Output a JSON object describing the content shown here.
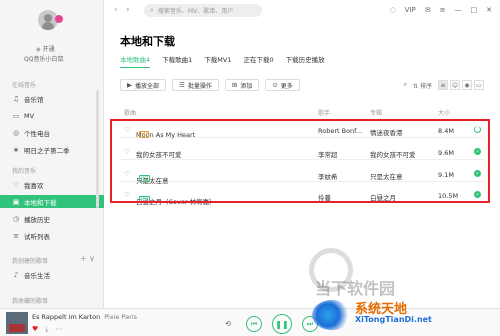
{
  "sidebar": {
    "open_label": "开通",
    "username": "QQ音乐小白鼠",
    "sections": [
      {
        "title": "在线音乐"
      },
      {
        "title": "我的音乐"
      },
      {
        "title": "我创建的歌单"
      },
      {
        "title": "我收藏的歌单"
      }
    ],
    "online_items": [
      {
        "label": "音乐馆",
        "icon": "music-hall-icon"
      },
      {
        "label": "MV",
        "icon": "mv-icon"
      },
      {
        "label": "个性电台",
        "icon": "radio-icon"
      },
      {
        "label": "明日之子第二季",
        "icon": "star-icon"
      }
    ],
    "my_items": [
      {
        "label": "我喜欢",
        "icon": "heart-icon"
      },
      {
        "label": "本地和下载",
        "icon": "computer-icon",
        "active": true
      },
      {
        "label": "播放历史",
        "icon": "history-icon"
      },
      {
        "label": "试听列表",
        "icon": "list-icon"
      }
    ],
    "created_items": [
      {
        "label": "音乐生活",
        "icon": "playlist-icon"
      }
    ]
  },
  "topbar": {
    "search_placeholder": "搜索音乐、MV、歌单、用户",
    "vip_label": "VIP"
  },
  "page": {
    "title": "本地和下载",
    "tabs": [
      "本地歌曲4",
      "下载歌曲1",
      "下载MV1",
      "正在下载0",
      "下载历史播放"
    ],
    "active_tab": 0
  },
  "toolbar": {
    "play_all": "播放全部",
    "batch": "批量操作",
    "add": "添加",
    "more": "更多",
    "sort": "排序"
  },
  "table": {
    "headers": [
      "歌曲",
      "歌手",
      "专辑",
      "大小"
    ],
    "rows": [
      {
        "title": "Moon As My Heart",
        "tag": "SQ",
        "tag_color": "#f0a030",
        "artist": "Robert Bonf...",
        "album": "情迷夜香港",
        "size": "8.4M",
        "status": "loading"
      },
      {
        "title": "我的女孩不可爱",
        "tag": "",
        "tag_color": "",
        "artist": "李常超",
        "album": "我的女孩不可爱",
        "size": "9.6M",
        "status": "done"
      },
      {
        "title": "只是太在意",
        "tag": "HQ",
        "tag_color": "#31c27c",
        "artist": "李蚊希",
        "album": "只是太在意",
        "size": "9.1M",
        "status": "done"
      },
      {
        "title": "白昼之月（Cover 林宥嘉）",
        "tag": "HQ",
        "tag_color": "#31c27c",
        "artist": "伶蔓",
        "album": "白昼之月",
        "size": "10.5M",
        "status": "done"
      }
    ]
  },
  "player": {
    "song": "Es Rappelt im Karton",
    "artist": "Pixie Paris"
  },
  "watermark": {
    "text": "当下软件园",
    "brand": "系统天地",
    "domain": "XiTongTianDi.net"
  }
}
